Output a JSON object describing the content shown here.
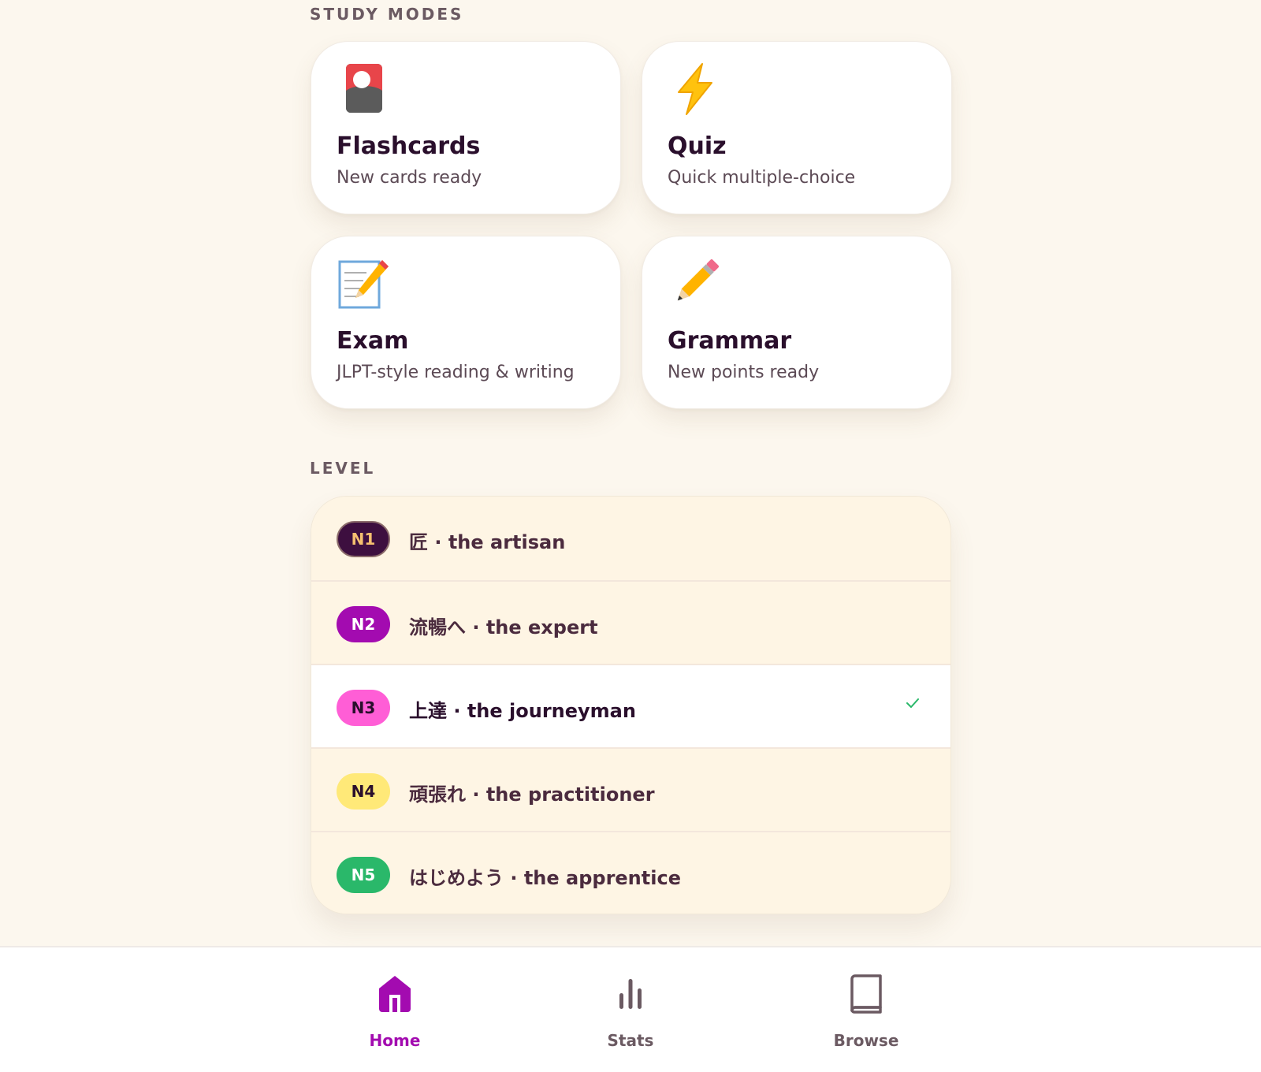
{
  "sections": {
    "modes_label": "STUDY MODES",
    "level_label": "LEVEL"
  },
  "modes": [
    {
      "title": "Flashcards",
      "subtitle": "New cards ready",
      "icon": "flashcard-icon"
    },
    {
      "title": "Quiz",
      "subtitle": "Quick multiple-choice",
      "icon": "lightning-icon"
    },
    {
      "title": "Exam",
      "subtitle": "JLPT-style reading & writing",
      "icon": "memo-icon"
    },
    {
      "title": "Grammar",
      "subtitle": "New points ready",
      "icon": "pencil-icon"
    }
  ],
  "levels": [
    {
      "badge": "N1",
      "label": "匠 · the artisan",
      "badge_bg": "#3d0f3f",
      "badge_fg": "#f5c070",
      "selected": false
    },
    {
      "badge": "N2",
      "label": "流暢へ · the expert",
      "badge_bg": "#a30bb0",
      "badge_fg": "#ffffff",
      "selected": false
    },
    {
      "badge": "N3",
      "label": "上達 · the journeyman",
      "badge_bg": "#ff5ed6",
      "badge_fg": "#2a0f2c",
      "selected": true
    },
    {
      "badge": "N4",
      "label": "頑張れ · the practitioner",
      "badge_bg": "#ffe978",
      "badge_fg": "#2a0f2c",
      "selected": false
    },
    {
      "badge": "N5",
      "label": "はじめよう · the apprentice",
      "badge_bg": "#2ab86a",
      "badge_fg": "#ffffff",
      "selected": false
    }
  ],
  "nav": {
    "home": "Home",
    "stats": "Stats",
    "browse": "Browse",
    "active": "home"
  },
  "colors": {
    "accent": "#a30bb0",
    "check": "#2ab86a",
    "background": "#fcf7ee"
  }
}
